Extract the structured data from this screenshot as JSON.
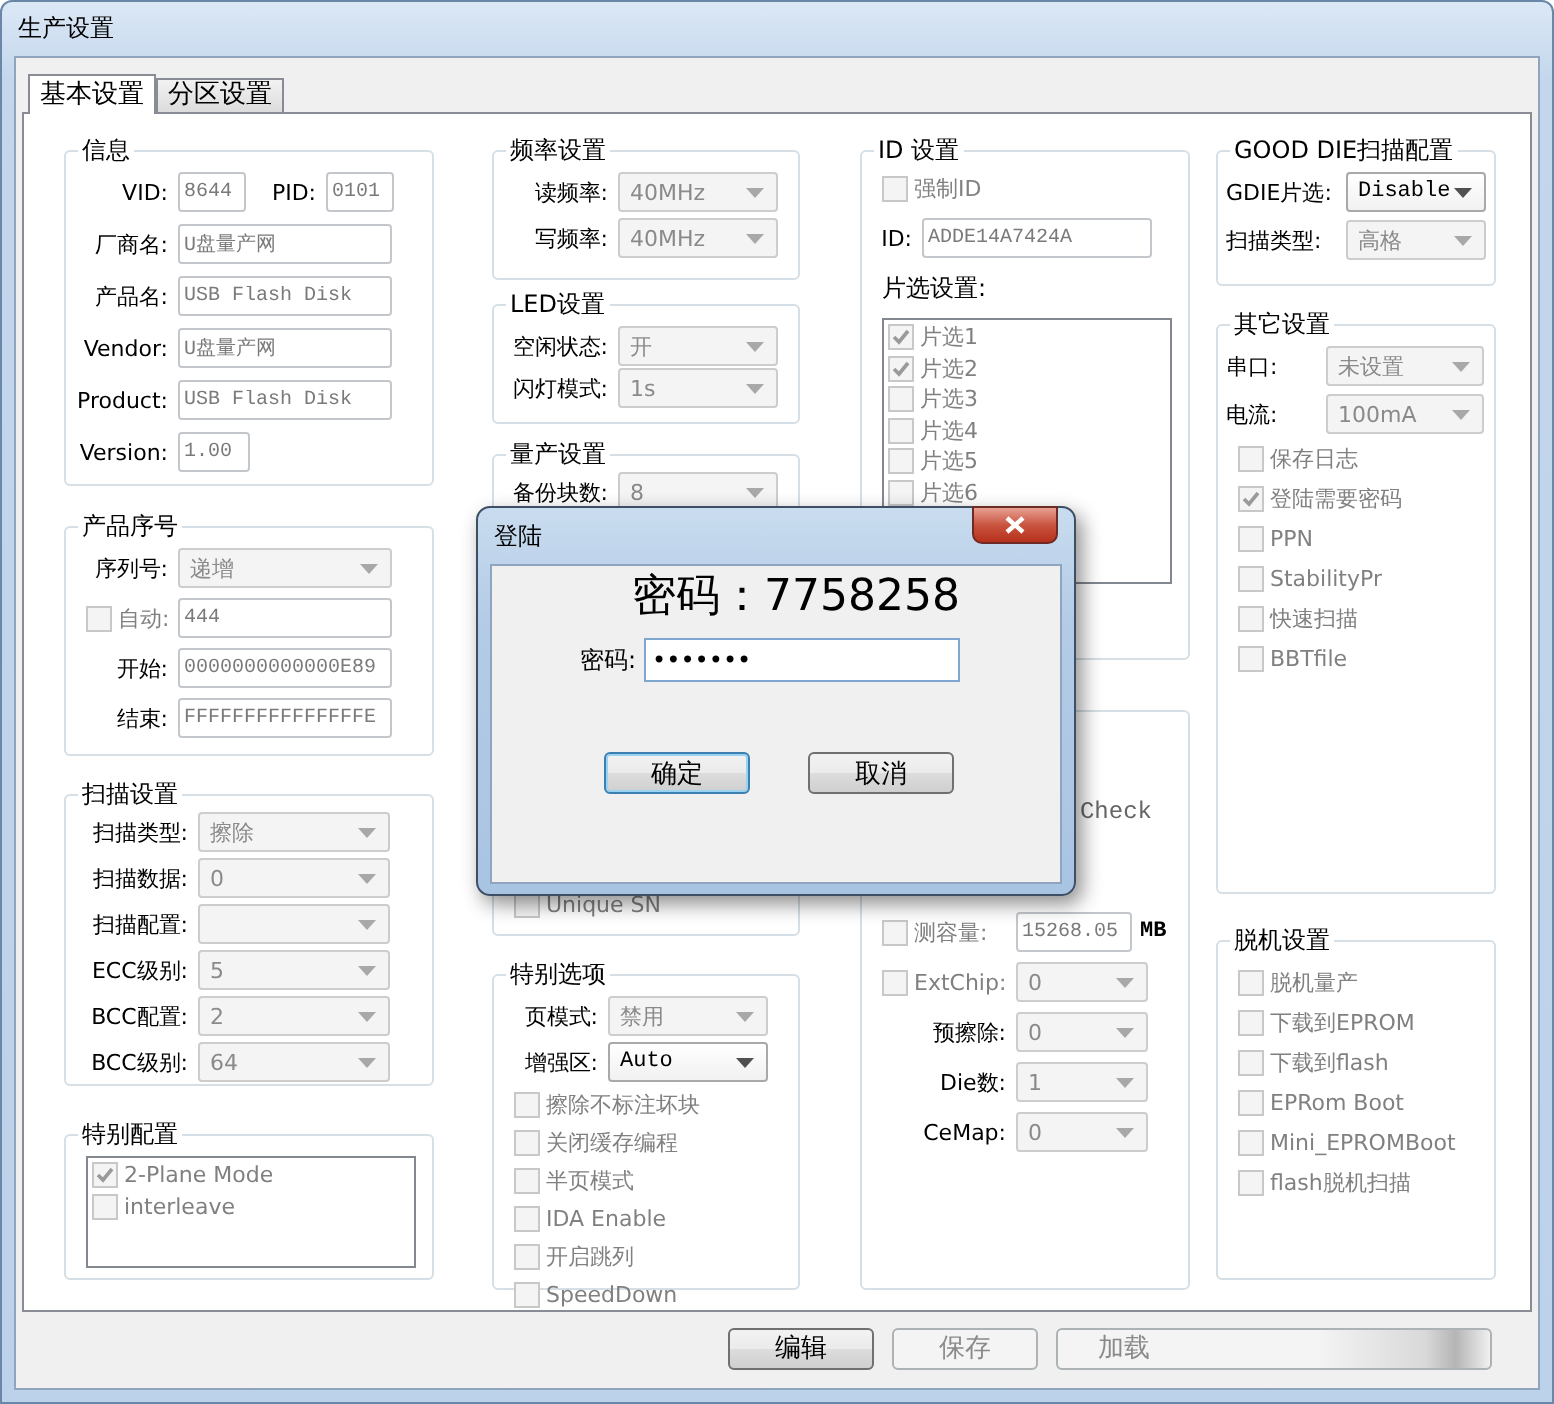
{
  "window": {
    "title": "生产设置"
  },
  "tabs": [
    {
      "label": "基本设置",
      "selected": true
    },
    {
      "label": "分区设置",
      "selected": false
    }
  ],
  "columns": [
    {
      "groups": [
        {
          "title": "信息",
          "rows": [
            {
              "kind": "pair",
              "items": [
                {
                  "label": "VID:",
                  "value": "8644",
                  "disabled": true
                },
                {
                  "label": "PID:",
                  "value": "0101",
                  "disabled": true
                }
              ]
            },
            {
              "kind": "field",
              "label": "厂商名:",
              "value": "U盘量产网",
              "disabled": true
            },
            {
              "kind": "field",
              "label": "产品名:",
              "value": "USB Flash Disk",
              "disabled": true
            },
            {
              "kind": "field",
              "label": "Vendor:",
              "value": "U盘量产网",
              "disabled": true
            },
            {
              "kind": "field",
              "label": "Product:",
              "value": "USB Flash Disk",
              "disabled": true
            },
            {
              "kind": "shortfield",
              "label": "Version:",
              "value": "1.00",
              "disabled": true
            }
          ]
        },
        {
          "title": "产品序号",
          "rows": [
            {
              "kind": "combo",
              "label": "序列号:",
              "value": "递增",
              "disabled": true
            },
            {
              "kind": "checkfield",
              "label": "自动:",
              "checked": false,
              "value": "444",
              "disabled": true
            },
            {
              "kind": "field",
              "label": "开始:",
              "value": "0000000000000E89",
              "disabled": true
            },
            {
              "kind": "field",
              "label": "结束:",
              "value": "FFFFFFFFFFFFFFFE",
              "disabled": true
            }
          ]
        },
        {
          "title": "扫描设置",
          "rows": [
            {
              "kind": "combo",
              "label": "扫描类型:",
              "value": "擦除",
              "disabled": true
            },
            {
              "kind": "combo",
              "label": "扫描数据:",
              "value": "0",
              "disabled": true
            },
            {
              "kind": "combo",
              "label": "扫描配置:",
              "disabled": true
            },
            {
              "kind": "combo",
              "label": "ECC级别:",
              "value": "5",
              "disabled": true
            },
            {
              "kind": "combo",
              "label": "BCC配置:",
              "value": "2",
              "disabled": true
            },
            {
              "kind": "combo",
              "label": "BCC级别:",
              "value": "64",
              "disabled": true
            }
          ]
        },
        {
          "title": "特别配置",
          "rows": [
            {
              "kind": "list",
              "items": [
                {
                  "label": "2-Plane Mode",
                  "checked": true
                },
                {
                  "label": "interleave",
                  "checked": false
                }
              ]
            }
          ]
        }
      ]
    },
    {
      "groups": [
        {
          "title": "频率设置",
          "rows": [
            {
              "kind": "combo",
              "label": "读频率:",
              "value": "40MHz",
              "disabled": true
            },
            {
              "kind": "combo",
              "label": "写频率:",
              "value": "40MHz",
              "disabled": true
            }
          ]
        },
        {
          "title": "LED设置",
          "rows": [
            {
              "kind": "combo",
              "label": "空闲状态:",
              "value": "开",
              "disabled": true
            },
            {
              "kind": "combo",
              "label": "闪灯模式:",
              "value": "1s",
              "disabled": true
            }
          ]
        },
        {
          "title": "量产设置",
          "rows": [
            {
              "kind": "combo",
              "label": "备份块数:",
              "value": "8",
              "disabled": true
            },
            {
              "kind": "check",
              "label": "Unique SN",
              "checked": false,
              "disabled": true
            }
          ]
        },
        {
          "title": "特别选项",
          "rows": [
            {
              "kind": "combo",
              "label": "页模式:",
              "value": "禁用",
              "disabled": true
            },
            {
              "kind": "combo",
              "label": "增强区:",
              "value": "Auto",
              "disabled": false
            },
            {
              "kind": "check",
              "label": "擦除不标注坏块",
              "checked": false,
              "disabled": true
            },
            {
              "kind": "check",
              "label": "关闭缓存编程",
              "checked": false,
              "disabled": true
            },
            {
              "kind": "check",
              "label": "半页模式",
              "checked": false,
              "disabled": true
            },
            {
              "kind": "check",
              "label": "IDA Enable",
              "checked": false,
              "disabled": true
            },
            {
              "kind": "check",
              "label": "开启跳列",
              "checked": false,
              "disabled": true
            },
            {
              "kind": "check",
              "label": "SpeedDown",
              "checked": false,
              "disabled": true
            }
          ]
        }
      ]
    },
    {
      "groups": [
        {
          "title": "ID 设置",
          "rows": [
            {
              "kind": "check",
              "label": "强制ID",
              "checked": false,
              "disabled": true
            },
            {
              "kind": "field",
              "label": "ID:",
              "value": "ADDE14A7424A",
              "disabled": true
            },
            {
              "kind": "caption",
              "label": "片选设置:"
            },
            {
              "kind": "list",
              "items": [
                {
                  "label": "片选1",
                  "checked": true
                },
                {
                  "label": "片选2",
                  "checked": true
                },
                {
                  "label": "片选3",
                  "checked": false
                },
                {
                  "label": "片选4",
                  "checked": false
                },
                {
                  "label": "片选5",
                  "checked": false
                },
                {
                  "label": "片选6",
                  "checked": false
                }
              ]
            }
          ]
        },
        {
          "rows": [
            {
              "kind": "fragment",
              "label": "Check"
            },
            {
              "kind": "checkfield",
              "label": "测容量:",
              "checked": false,
              "value": "15268.05",
              "unit": "MB",
              "disabled": true
            },
            {
              "kind": "checkcombo",
              "label": "ExtChip:",
              "checked": false,
              "value": "0",
              "disabled": true
            },
            {
              "kind": "combo",
              "label": "预擦除:",
              "value": "0",
              "disabled": true
            },
            {
              "kind": "combo",
              "label": "Die数:",
              "value": "1",
              "disabled": true
            },
            {
              "kind": "combo",
              "label": "CeMap:",
              "value": "0",
              "disabled": true
            }
          ]
        }
      ]
    },
    {
      "groups": [
        {
          "title": "GOOD DIE扫描配置",
          "rows": [
            {
              "kind": "combo",
              "label": "GDIE片选:",
              "value": "Disable",
              "disabled": false
            },
            {
              "kind": "combo",
              "label": "扫描类型:",
              "value": "高格",
              "disabled": true
            }
          ]
        },
        {
          "title": "其它设置",
          "rows": [
            {
              "kind": "combo",
              "label": "串口:",
              "value": "未设置",
              "disabled": true
            },
            {
              "kind": "combo",
              "label": "电流:",
              "value": "100mA",
              "disabled": true
            },
            {
              "kind": "check",
              "label": "保存日志",
              "checked": false,
              "disabled": true
            },
            {
              "kind": "check",
              "label": "登陆需要密码",
              "checked": true,
              "disabled": true
            },
            {
              "kind": "check",
              "label": "PPN",
              "checked": false,
              "disabled": true
            },
            {
              "kind": "check",
              "label": "StabilityPr",
              "checked": false,
              "disabled": true
            },
            {
              "kind": "check",
              "label": "快速扫描",
              "checked": false,
              "disabled": true
            },
            {
              "kind": "check",
              "label": "BBTfile",
              "checked": false,
              "disabled": true
            }
          ]
        },
        {
          "title": "脱机设置",
          "rows": [
            {
              "kind": "check",
              "label": "脱机量产",
              "checked": false,
              "disabled": true
            },
            {
              "kind": "check",
              "label": "下载到EPROM",
              "checked": false,
              "disabled": true
            },
            {
              "kind": "check",
              "label": "下载到flash",
              "checked": false,
              "disabled": true
            },
            {
              "kind": "check",
              "label": "EPRom Boot",
              "checked": false,
              "disabled": true
            },
            {
              "kind": "check",
              "label": "Mini_EPROMBoot",
              "checked": false,
              "disabled": true
            },
            {
              "kind": "check",
              "label": "flash脱机扫描",
              "checked": false,
              "disabled": true
            }
          ]
        }
      ]
    }
  ],
  "buttons": [
    {
      "label": "编辑",
      "disabled": false
    },
    {
      "label": "保存",
      "disabled": true
    },
    {
      "label": "加载",
      "disabled": true
    }
  ],
  "dialog": {
    "title": "登陆",
    "heading": "密码：7758258",
    "field_label": "密码:",
    "value": "•••••••",
    "buttons": [
      {
        "label": "确定",
        "focused": true
      },
      {
        "label": "取消",
        "focused": false
      }
    ]
  }
}
